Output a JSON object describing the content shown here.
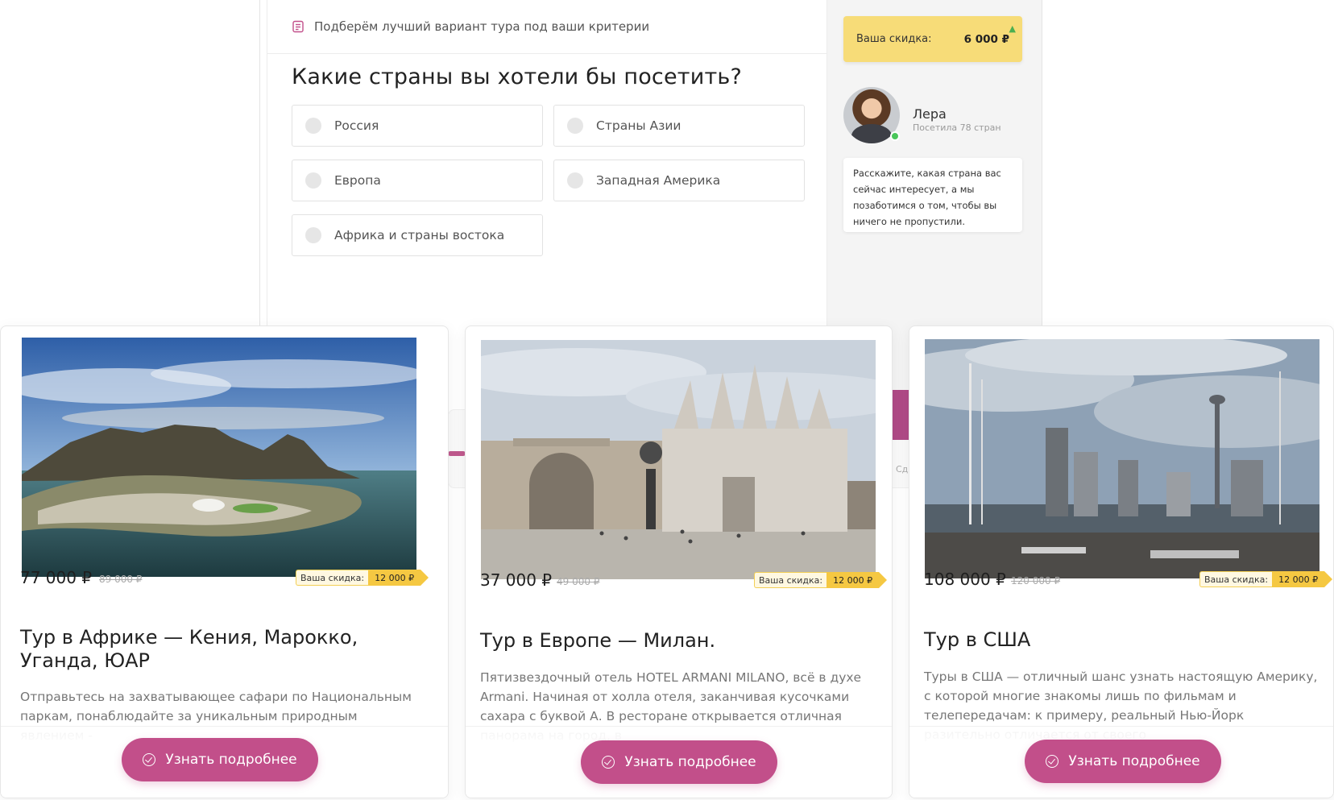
{
  "quiz": {
    "header_text": "Подберём лучший вариант тура под ваши критерии",
    "question": "Какие страны вы хотели бы посетить?",
    "options": [
      "Россия",
      "Страны Азии",
      "Европа",
      "Западная Америка",
      "Африка и страны востока"
    ]
  },
  "sidebar": {
    "discount_label": "Ваша скидка:",
    "discount_value": "6 000 ₽",
    "agent_name": "Лера",
    "agent_subtitle": "Посетила 78 стран",
    "message": "Расскажите, какая страна вас сейчас интересует, а мы позаботимся о том, чтобы вы ничего не пропустили."
  },
  "peek_text": "Сд",
  "cards": [
    {
      "price": "77 000 ₽",
      "old_price": "89 000 ₽",
      "discount_label": "Ваша скидка:",
      "discount_value": "12 000 ₽",
      "title": "Тур в Африке — Кения, Марокко, Уганда, ЮАР",
      "desc": "Отправьтесь на захватывающее сафари по Национальным паркам, понаблюдайте за уникальным природным явлением -",
      "button": "Узнать подробнее"
    },
    {
      "price": "37 000 ₽",
      "old_price": "49 000 ₽",
      "discount_label": "Ваша скидка:",
      "discount_value": "12 000 ₽",
      "title": "Тур в Европе — Милан.",
      "desc": "Пятизвездочный отель HOTEL ARMANI MILANO, всё в духе Armani. Начиная от холла отеля, заканчивая кусочками сахара с буквой А. В ресторане открывается отличная панорама на город, в",
      "button": "Узнать подробнее"
    },
    {
      "price": "108 000 ₽",
      "old_price": "120 000 ₽",
      "discount_label": "Ваша скидка:",
      "discount_value": "12 000 ₽",
      "title": "Тур в США",
      "desc": "Туры в США — отличный шанс узнать настоящую Америку, с которой многие знакомы лишь по фильмам и телепередачам: к примеру, реальный Нью-Йорк разительно отличается от своего",
      "button": "Узнать подробнее"
    }
  ]
}
